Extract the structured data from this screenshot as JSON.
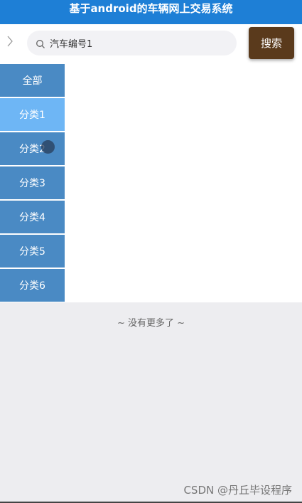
{
  "app": {
    "title": "基于android的车辆网上交易系统"
  },
  "search": {
    "back_icon": "chevron-right-icon",
    "search_icon": "search-icon",
    "value": "汽车编号1",
    "button_label": "搜索"
  },
  "sidebar": {
    "items": [
      {
        "label": "全部",
        "active": false
      },
      {
        "label": "分类1",
        "active": true
      },
      {
        "label": "分类2",
        "active": false
      },
      {
        "label": "分类3",
        "active": false
      },
      {
        "label": "分类4",
        "active": false
      },
      {
        "label": "分类5",
        "active": false
      },
      {
        "label": "分类6",
        "active": false
      }
    ]
  },
  "list": {
    "end_text": "~ 没有更多了 ~"
  },
  "watermark": "CSDN @丹丘毕设程序",
  "colors": {
    "title_bar": "#1e7fd6",
    "search_button": "#5a3a1c",
    "category": "#4a8ac4",
    "category_active": "#6eb6f5",
    "footer_bg": "#ededf0"
  }
}
